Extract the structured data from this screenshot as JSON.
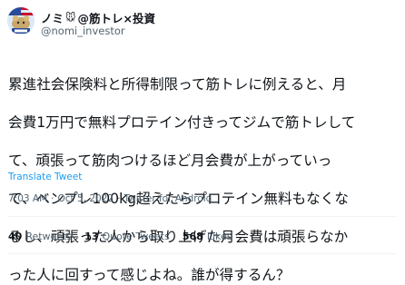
{
  "tweet": {
    "display_name": "ノミ",
    "display_name_suffix": "@筋トレ×投資",
    "name_icon": "mouse-icon",
    "handle": "@nomi_investor",
    "avatar_icon": "nomi-avatar-icon",
    "body_lines": [
      "累進社会保険料と所得制限って筋トレに例えると、月",
      "会費1万円で無料プロテイン付きってジムで筋トレして",
      "て、頑張って筋肉つけるほど月会費が上がっていっ",
      "て、ベンプレ100kg超えたらプロテイン無料もなくな",
      "るし、頑張った人から取り上げた月会費は頑張らなか",
      "った人に回すって感じよね。誰が得するん？"
    ],
    "translate_label": "Translate Tweet",
    "time": "7:03 AM",
    "date": "Oct 5, 2022",
    "source": "Twitter for Android",
    "separator": "·",
    "retweets_count": "40",
    "retweets_label": "Retweets",
    "quotes_count": "13",
    "quotes_label": "Quote Tweets",
    "likes_count": "568",
    "likes_label": "Likes"
  },
  "colors": {
    "text": "#0f1419",
    "secondary": "#536471",
    "link": "#1d9bf0",
    "divider": "#eff3f4"
  }
}
